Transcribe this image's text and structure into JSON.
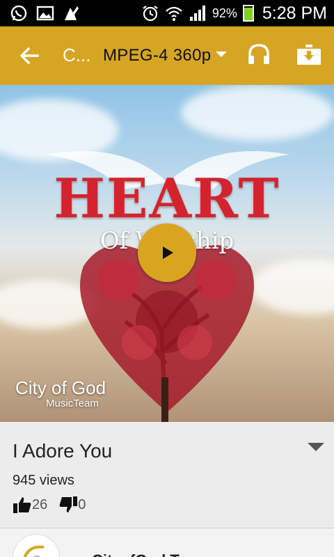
{
  "status_bar": {
    "battery_percent": "92%",
    "battery_level": 0.92,
    "time": "5:28 PM",
    "icons": [
      "whatsapp-icon",
      "gallery-icon",
      "app-notification-icon",
      "alarm-icon",
      "wifi-icon",
      "signal-icon",
      "battery-icon"
    ]
  },
  "toolbar": {
    "title": "C...",
    "quality": "MPEG-4 360p",
    "accent_color": "#d6a524"
  },
  "artwork": {
    "title": "HEART",
    "subtitle": "Of Worship",
    "brand_main": "City of God",
    "brand_sub": "MusicTeam"
  },
  "video": {
    "title": "I Adore You",
    "views": "945 views",
    "likes": "26",
    "dislikes": "0"
  },
  "channel": {
    "name": "CityofGod T..."
  }
}
